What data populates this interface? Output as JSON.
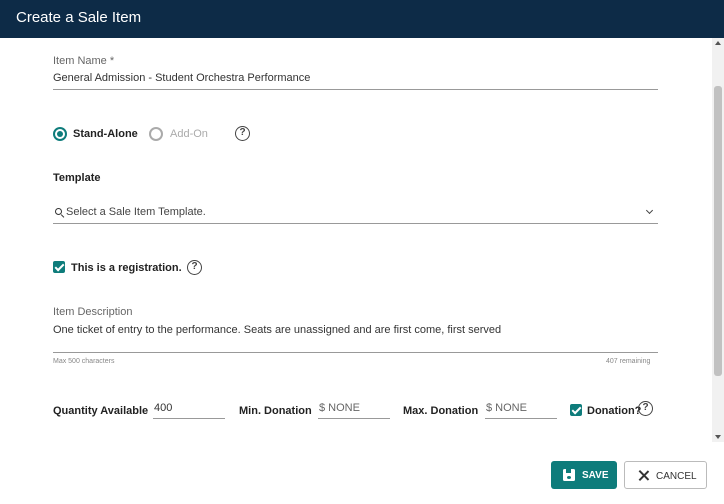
{
  "dialog": {
    "title": "Create a Sale Item"
  },
  "item_name": {
    "label": "Item Name *",
    "value": "General Admission - Student Orchestra Performance"
  },
  "item_type": {
    "options": [
      {
        "label": "Stand-Alone",
        "selected": true
      },
      {
        "label": "Add-On",
        "selected": false
      }
    ],
    "help_icon": "help-circle-icon"
  },
  "template": {
    "heading": "Template",
    "placeholder": "Select a Sale Item Template."
  },
  "registration": {
    "label": "This is a registration.",
    "checked": true
  },
  "description": {
    "label": "Item Description",
    "value": "One ticket of entry to the performance. Seats are unassigned and are first come, first served",
    "max_hint": "Max 500 characters",
    "remaining": "407 remaining"
  },
  "quantity": {
    "label": "Quantity Available",
    "value": "400"
  },
  "min_donation": {
    "label": "Min. Donation",
    "placeholder": "$ NONE"
  },
  "max_donation": {
    "label": "Max. Donation",
    "placeholder": "$ NONE"
  },
  "donation": {
    "label": "Donation?",
    "checked": true
  },
  "buttons": {
    "save": "SAVE",
    "cancel": "CANCEL"
  },
  "colors": {
    "header": "#0d2b47",
    "accent": "#0e7c7b"
  }
}
